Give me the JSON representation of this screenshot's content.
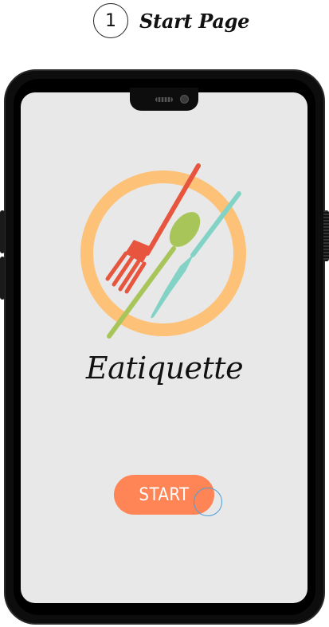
{
  "step": {
    "number": "1",
    "title": "Start Page"
  },
  "app": {
    "name": "Eatiquette"
  },
  "start_button": {
    "label": "START"
  },
  "colors": {
    "plate": "#fdc177",
    "fork": "#e8553f",
    "spoon": "#a8c55a",
    "knife": "#82d3c6",
    "button": "#ff8456",
    "screen": "#e8e8e8"
  },
  "icons": [
    "plate-icon",
    "fork-icon",
    "spoon-icon",
    "knife-icon",
    "tap-indicator"
  ]
}
